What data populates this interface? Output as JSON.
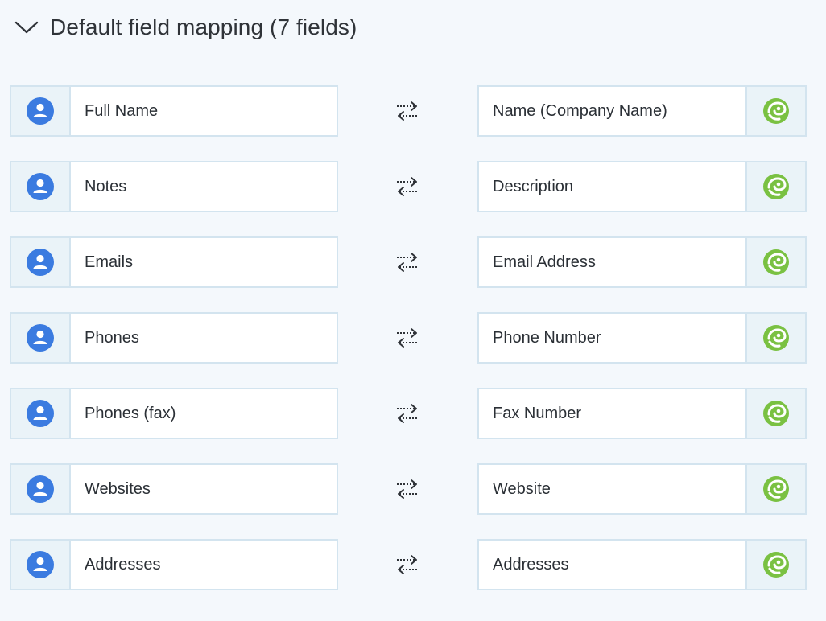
{
  "section": {
    "title": "Default field mapping (7 fields)",
    "icon": "chevron-down-icon"
  },
  "mappings": [
    {
      "source": "Full Name",
      "target": "Name (Company Name)"
    },
    {
      "source": "Notes",
      "target": "Description"
    },
    {
      "source": "Emails",
      "target": "Email Address"
    },
    {
      "source": "Phones",
      "target": "Phone Number"
    },
    {
      "source": "Phones (fax)",
      "target": "Fax Number"
    },
    {
      "source": "Websites",
      "target": "Website"
    },
    {
      "source": "Addresses",
      "target": "Addresses"
    }
  ],
  "icons": {
    "source": "contact-person-icon",
    "target": "app-logo-icon",
    "swap": "swap-arrows-icon"
  },
  "colors": {
    "background": "#f4f8fc",
    "border": "#d3e4ef",
    "icon_cell": "#eaf3f8",
    "source_icon": "#3b7be0",
    "target_icon": "#7ac142"
  }
}
